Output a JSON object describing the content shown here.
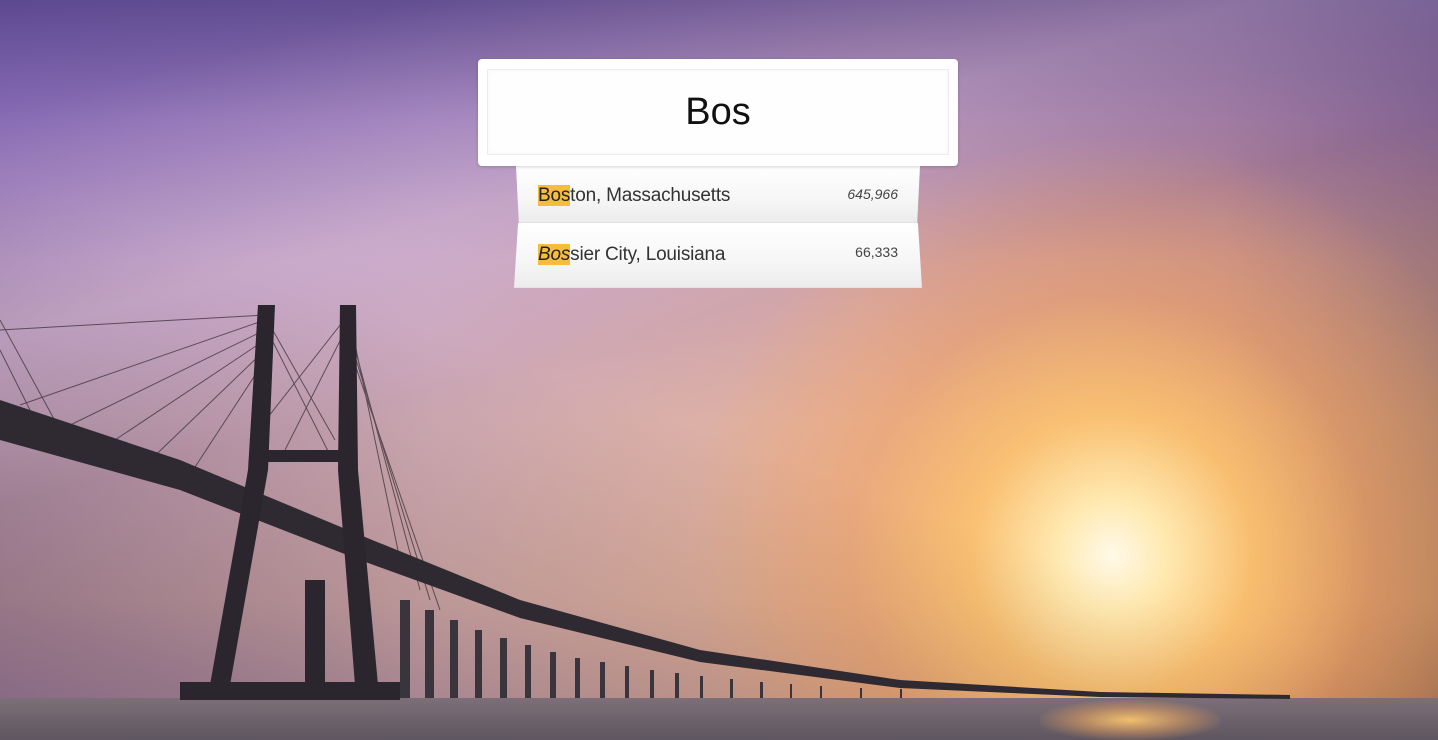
{
  "search": {
    "value": "Bos",
    "highlight": "Bos"
  },
  "suggestions": [
    {
      "match": "Bos",
      "rest": "ton, Massachusetts",
      "population": "645,966"
    },
    {
      "match": "Bos",
      "rest": "sier City, Louisiana",
      "population": "66,333"
    }
  ],
  "colors": {
    "highlight": "#f6bd3c",
    "card": "#ffffff"
  }
}
